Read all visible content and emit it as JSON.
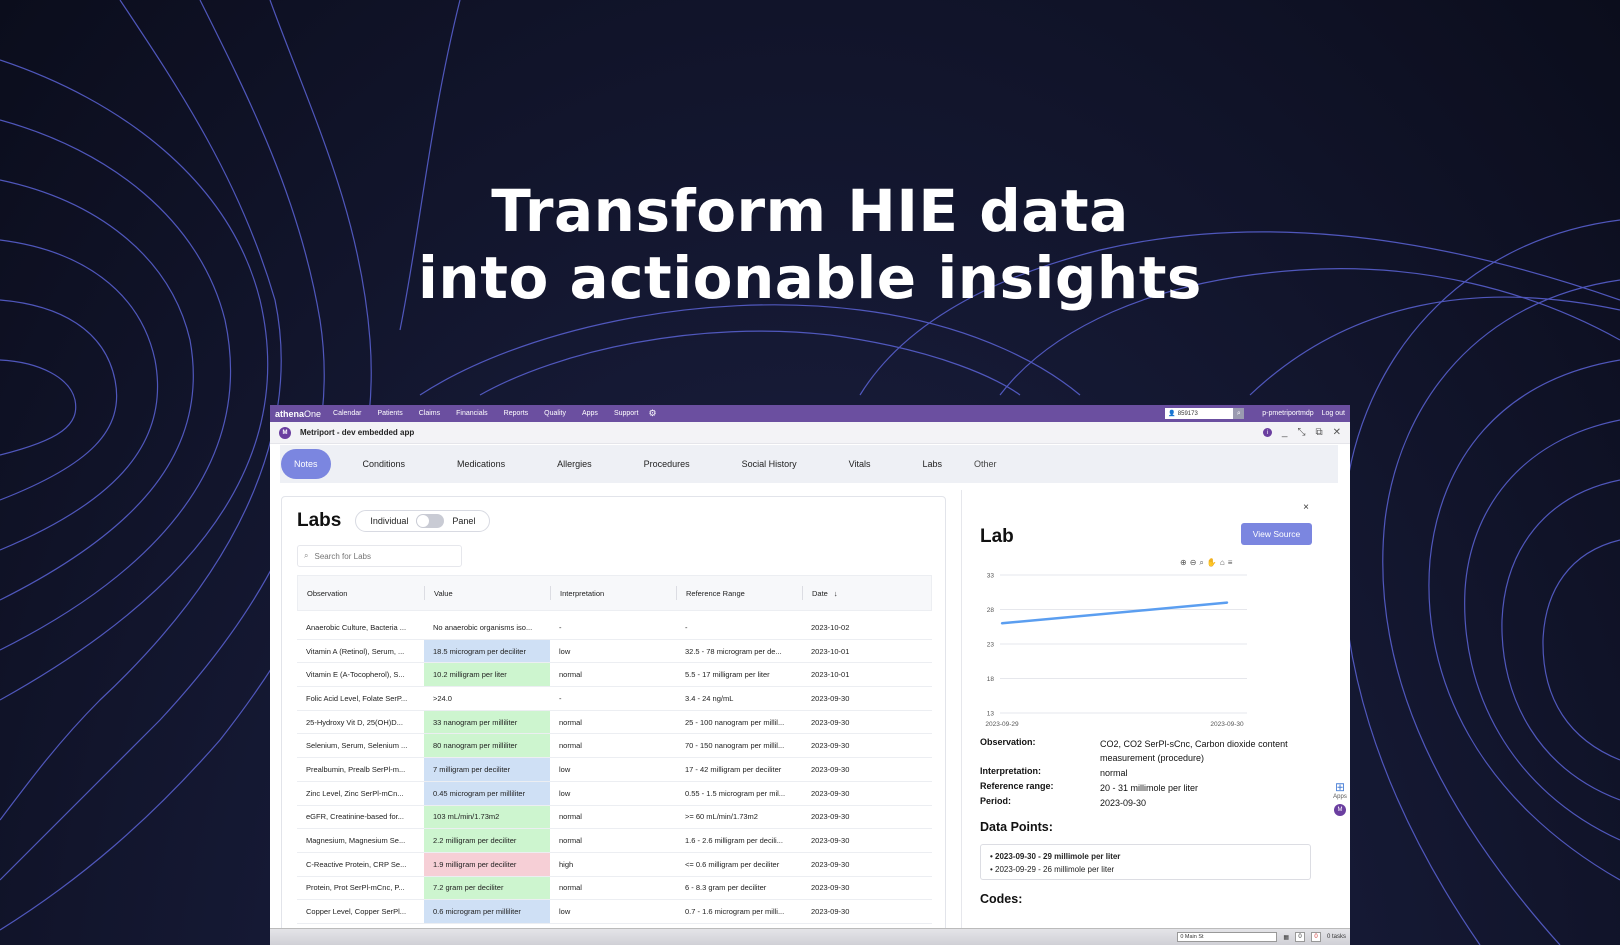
{
  "headline": {
    "line1": "Transform HIE data",
    "line2": "into actionable insights"
  },
  "topbar": {
    "brand_bold": "athena",
    "brand_light": "One",
    "nav": [
      "Calendar",
      "Patients",
      "Claims",
      "Financials",
      "Reports",
      "Quality",
      "Apps",
      "Support"
    ],
    "patient_id": "859173",
    "username": "p-pmetriportmdp",
    "logout": "Log out"
  },
  "titlebar": {
    "avatar": "M",
    "title": "Metriport - dev embedded app"
  },
  "tabs": [
    "Notes",
    "Conditions",
    "Medications",
    "Allergies",
    "Procedures",
    "Social History",
    "Vitals",
    "Labs",
    "Other"
  ],
  "labs": {
    "title": "Labs",
    "toggle_left": "Individual",
    "toggle_right": "Panel",
    "search_placeholder": "Search for Labs",
    "columns": [
      "Observation",
      "Value",
      "Interpretation",
      "Reference Range",
      "Date"
    ],
    "rows": [
      {
        "obs": "Anaerobic Culture, Bacteria ...",
        "value": "No anaerobic organisms iso...",
        "interp": "-",
        "range": "-",
        "date": "2023-10-02",
        "color": "none"
      },
      {
        "obs": "Vitamin A (Retinol), Serum, ...",
        "value": "18.5 microgram per deciliter",
        "interp": "low",
        "range": "32.5 - 78 microgram per de...",
        "date": "2023-10-01",
        "color": "blue"
      },
      {
        "obs": "Vitamin E (A-Tocopherol), S...",
        "value": "10.2 milligram per liter",
        "interp": "normal",
        "range": "5.5 - 17 milligram per liter",
        "date": "2023-10-01",
        "color": "green"
      },
      {
        "obs": "Folic Acid Level, Folate SerP...",
        "value": ">24.0",
        "interp": "-",
        "range": "3.4 - 24 ng/mL",
        "date": "2023-09-30",
        "color": "none"
      },
      {
        "obs": "25-Hydroxy Vit D, 25(OH)D...",
        "value": "33 nanogram per milliliter",
        "interp": "normal",
        "range": "25 - 100 nanogram per millil...",
        "date": "2023-09-30",
        "color": "green"
      },
      {
        "obs": "Selenium, Serum, Selenium ...",
        "value": "80 nanogram per milliliter",
        "interp": "normal",
        "range": "70 - 150 nanogram per millil...",
        "date": "2023-09-30",
        "color": "green"
      },
      {
        "obs": "Prealbumin, Prealb SerPl-m...",
        "value": "7 milligram per deciliter",
        "interp": "low",
        "range": "17 - 42 milligram per deciliter",
        "date": "2023-09-30",
        "color": "blue"
      },
      {
        "obs": "Zinc Level, Zinc SerPl-mCn...",
        "value": "0.45 microgram per milliliter",
        "interp": "low",
        "range": "0.55 - 1.5 microgram per mil...",
        "date": "2023-09-30",
        "color": "blue"
      },
      {
        "obs": "eGFR, Creatinine-based for...",
        "value": "103 mL/min/1.73m2",
        "interp": "normal",
        "range": ">= 60 mL/min/1.73m2",
        "date": "2023-09-30",
        "color": "green"
      },
      {
        "obs": "Magnesium, Magnesium Se...",
        "value": "2.2 milligram per deciliter",
        "interp": "normal",
        "range": "1.6 - 2.6 milligram per decili...",
        "date": "2023-09-30",
        "color": "green"
      },
      {
        "obs": "C-Reactive Protein, CRP Se...",
        "value": "1.9 milligram per deciliter",
        "interp": "high",
        "range": "<= 0.6 milligram per deciliter",
        "date": "2023-09-30",
        "color": "red"
      },
      {
        "obs": "Protein, Prot SerPl-mCnc, P...",
        "value": "7.2 gram per deciliter",
        "interp": "normal",
        "range": "6 - 8.3 gram per deciliter",
        "date": "2023-09-30",
        "color": "green"
      },
      {
        "obs": "Copper Level, Copper SerPl...",
        "value": "0.6 microgram per milliliter",
        "interp": "low",
        "range": "0.7 - 1.6 microgram per milli...",
        "date": "2023-09-30",
        "color": "blue"
      }
    ]
  },
  "detail": {
    "close": "×",
    "title": "Lab",
    "view_source": "View Source",
    "observation_label": "Observation:",
    "observation": "CO2, CO2 SerPl-sCnc, Carbon dioxide content measurement (procedure)",
    "interpretation_label": "Interpretation:",
    "interpretation": "normal",
    "range_label": "Reference range:",
    "range": "20 - 31 millimole per liter",
    "period_label": "Period:",
    "period": "2023-09-30",
    "data_points_title": "Data Points:",
    "data_point_1": "• 2023-09-30 - 29 millimole per liter",
    "data_point_2": "• 2023-09-29 - 26 millimole per liter",
    "codes_title": "Codes:"
  },
  "chart_data": {
    "type": "line",
    "x": [
      "2023-09-29",
      "2023-09-30"
    ],
    "series": [
      {
        "values": [
          26,
          29
        ]
      }
    ],
    "y_ticks": [
      33,
      28,
      23,
      18,
      13
    ],
    "ylim": [
      13,
      33
    ],
    "color": "#5b9ef0",
    "grid": true
  },
  "side": {
    "apps_label": "Apps",
    "avatar": "M"
  },
  "statusbar": {
    "location": "0 Main St",
    "count1": "0",
    "count2": "0",
    "tasks": "0 tasks"
  },
  "colors": {
    "accent": "#7b86e0",
    "topbar": "#6b4fa0",
    "low": "#cfe0f5",
    "normal": "#cdf5cf",
    "high": "#f6cfd6"
  }
}
